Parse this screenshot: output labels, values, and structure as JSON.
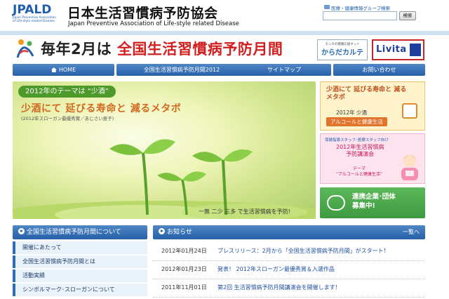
{
  "header": {
    "logo_mark": "JPALD",
    "logo_sub": [
      "Japan Preventive Association",
      "of Life-style related Disease"
    ],
    "title": "日本生活習慣病予防協会",
    "subtitle": "Japan Preventive Association of Life-style related Disease",
    "search_label": "医療・健康情報グループ検索",
    "search_button": "検索"
  },
  "campaign": {
    "prefix": "毎年2月は",
    "highlight": "全国生活習慣病予防月間",
    "karada_small": "タニタの健康応援ネット",
    "karada_big": "からだカルテ",
    "livita": "Livita"
  },
  "nav": {
    "items": [
      {
        "label": "HOME"
      },
      {
        "label": "全国生活習慣病予防月間2012"
      },
      {
        "label": "サイトマップ"
      },
      {
        "label": "お問い合わせ"
      }
    ]
  },
  "hero": {
    "theme": "2012年のテーマは “少酒”",
    "slogan": "少酒にて 延びる寿命と 減るメタボ",
    "credit": "(2012年スローガン最優秀賞／あじさい恵子)",
    "footer": "一無 二少 三多 で生活習慣病を予防!"
  },
  "side_banners": {
    "alcohol": {
      "line1": "少酒にて 延びる寿命と 減るメタボ",
      "year": "2012年 少酒",
      "pill": "アルコールと健康生活"
    },
    "lecture": {
      "top": "保健指導スタッフ･医療スタッフ向け",
      "title1": "2012年生活習慣病",
      "title2": "予防講演会",
      "theme_label": "テーマ",
      "theme": "“アルコールと健康生活”"
    },
    "partners": {
      "line1": "連携企業･団体",
      "line2": "募集中!"
    }
  },
  "menu": {
    "head": "全国生活習慣病予防月間について",
    "items": [
      {
        "label": "開催にあたって"
      },
      {
        "label": "全国生活習慣病予防月間とは"
      },
      {
        "label": "活動実績"
      },
      {
        "label": "シンボルマーク･スローガンについて"
      }
    ]
  },
  "news": {
    "head": "お知らせ",
    "more": "一覧へ",
    "rows": [
      {
        "date": "2012年01月24日",
        "title": "プレスリリース：2月から「全国生活習慣病予防月間」がスタート！"
      },
      {
        "date": "2012年01月23日",
        "title": "発表！ 2012年スローガン最優秀賞＆入選作品"
      },
      {
        "date": "2011年11月01日",
        "title": "第2回 生活習慣病予防月間講演会を開催します！"
      }
    ]
  }
}
